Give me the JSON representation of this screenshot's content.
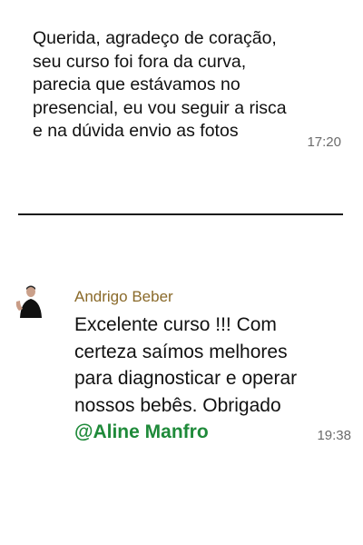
{
  "message_1": {
    "text": "Querida, agradeço de coração,\nseu curso foi fora da curva,\nparecia que estávamos no\npresencial, eu vou seguir a risca\ne na dúvida envio as fotos",
    "time": "17:20"
  },
  "message_2": {
    "sender": "Andrigo Beber",
    "text": "Excelente curso !!! Com\ncerteza saímos melhores\npara diagnosticar e operar\nnossos bebês. Obrigado\n",
    "mention": "@Aline Manfro",
    "time": "19:38"
  },
  "colors": {
    "sender": "#8a6a2a",
    "mention": "#1f8a3a",
    "time": "#6b6b6b"
  }
}
